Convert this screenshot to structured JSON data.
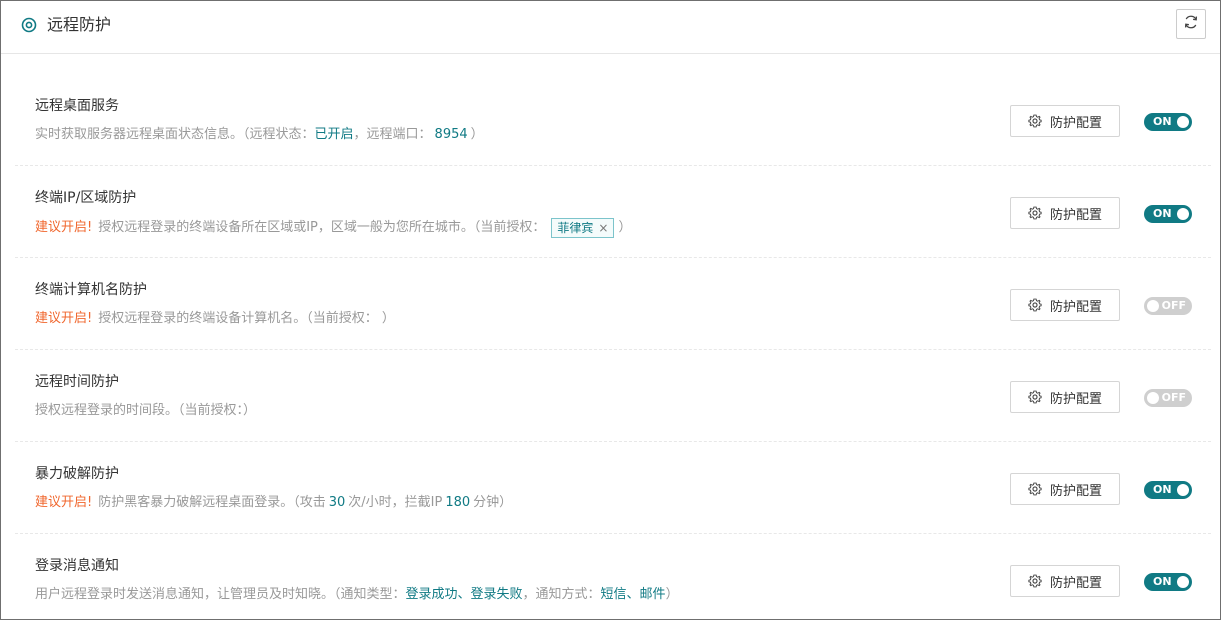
{
  "header": {
    "title": "远程防护",
    "icon": "target-circle-icon",
    "refresh_icon": "refresh-icon"
  },
  "colors": {
    "accent": "#107a84",
    "warning": "#f0672e",
    "muted": "#999999",
    "toggle_off": "#cfcfcf"
  },
  "config_button_label": "防护配置",
  "rows": [
    {
      "title": "远程桌面服务",
      "desc_1": "实时获取服务器远程桌面状态信息。（远程状态：",
      "status_value": "已开启",
      "desc_2": "，远程端口：",
      "port_value": "8954",
      "desc_3": "）",
      "toggle": "ON"
    },
    {
      "title": "终端IP/区域防护",
      "warning": "建议开启!",
      "desc_1": "授权远程登录的终端设备所在区域或IP，区域一般为您所在城市。（当前授权：",
      "tag": "菲律宾",
      "tag_close": "×",
      "desc_2": "）",
      "toggle": "ON"
    },
    {
      "title": "终端计算机名防护",
      "warning": "建议开启!",
      "desc_1": "授权远程登录的终端设备计算机名。（当前授权：  ）",
      "toggle": "OFF"
    },
    {
      "title": "远程时间防护",
      "desc_1": "授权远程登录的时间段。（当前授权：）",
      "toggle": "OFF"
    },
    {
      "title": "暴力破解防护",
      "warning": "建议开启!",
      "desc_1": "防护黑客暴力破解远程桌面登录。（攻击",
      "attack_value": "30",
      "desc_2": "次/小时，拦截IP",
      "block_value": "180",
      "desc_3": "分钟）",
      "toggle": "ON"
    },
    {
      "title": "登录消息通知",
      "desc_1": "用户远程登录时发送消息通知，让管理员及时知晓。（通知类型：",
      "notify_types": "登录成功、登录失败",
      "desc_2": "，通知方式：",
      "notify_methods": "短信、邮件",
      "desc_3": "）",
      "toggle": "ON"
    }
  ]
}
